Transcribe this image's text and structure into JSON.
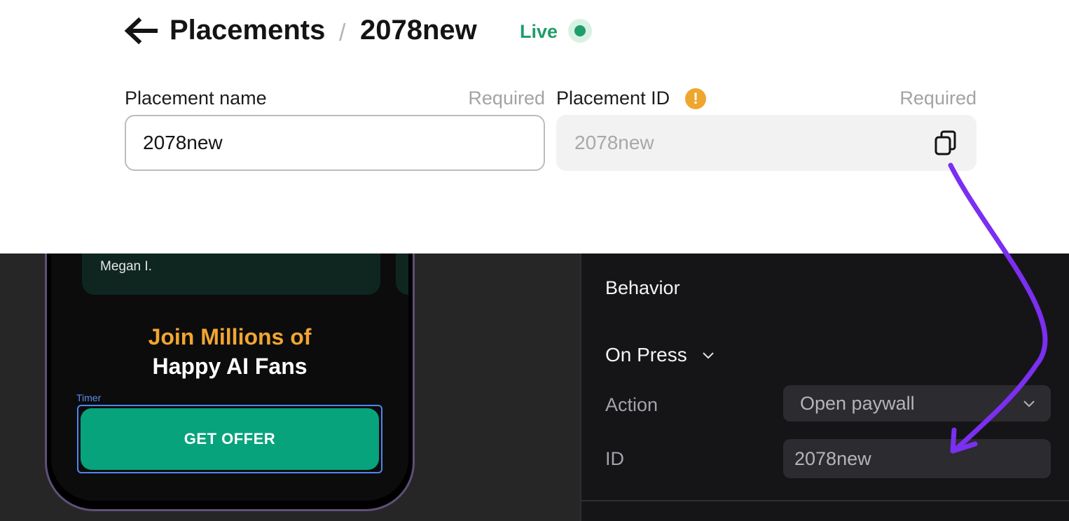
{
  "header": {
    "breadcrumb_parent": "Placements",
    "breadcrumb_separator": "/",
    "breadcrumb_current": "2078new",
    "status": "Live",
    "status_color": "#1f9d6b"
  },
  "form": {
    "name_label": "Placement name",
    "name_required": "Required",
    "name_value": "2078new",
    "id_label": "Placement ID",
    "id_required": "Required",
    "id_value": "2078new",
    "warning_glyph": "!",
    "warning_color": "#efa630"
  },
  "preview": {
    "reviewer": "Megan I.",
    "headline_line1": "Join Millions of",
    "headline_line2": "Happy AI Fans",
    "timer_label": "Timer",
    "offer_button": "GET OFFER",
    "headline_accent": "#f2a531",
    "button_color": "#07a37c"
  },
  "panel": {
    "section_title": "Behavior",
    "trigger": "On Press",
    "action_label": "Action",
    "action_value": "Open paywall",
    "id_label": "ID",
    "id_value": "2078new"
  },
  "annotation": {
    "arrow_color": "#7b2ff0",
    "icons": [
      "arrow-left-icon",
      "copy-icon",
      "chevron-down-icon",
      "curved-arrow-icon"
    ]
  }
}
